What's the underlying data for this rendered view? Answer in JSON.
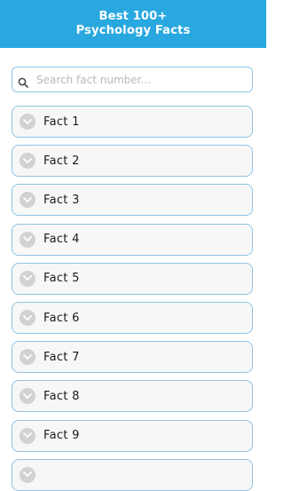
{
  "header": {
    "title_line1": "Best 100+",
    "title_line2": "Psychology Facts"
  },
  "search": {
    "placeholder": "Search fact number..."
  },
  "facts": [
    {
      "label": "Fact 1"
    },
    {
      "label": "Fact 2"
    },
    {
      "label": "Fact 3"
    },
    {
      "label": "Fact 4"
    },
    {
      "label": "Fact 5"
    },
    {
      "label": "Fact 6"
    },
    {
      "label": "Fact 7"
    },
    {
      "label": "Fact 8"
    },
    {
      "label": "Fact 9"
    },
    {
      "label": ""
    }
  ],
  "colors": {
    "header_bg": "#29a8e0",
    "item_border": "#8fc3e6",
    "item_bg": "#f7f7f7",
    "chevron_circle": "#d2d2d2"
  }
}
